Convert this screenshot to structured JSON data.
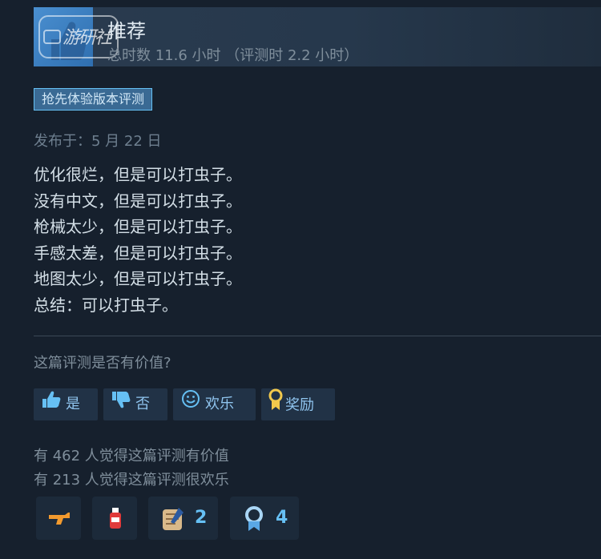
{
  "header": {
    "title": "推荐",
    "hours": "总时数 11.6 小时 （评测时 2.2 小时）",
    "watermark": "游研社"
  },
  "review": {
    "tag": "抢先体验版本评测",
    "posted": "发布于：5 月 22 日",
    "lines": [
      "优化很烂，但是可以打虫子。",
      "没有中文，但是可以打虫子。",
      "枪械太少，但是可以打虫子。",
      "手感太差，但是可以打虫子。",
      "地图太少，但是可以打虫子。",
      "总结：可以打虫子。"
    ]
  },
  "feedback": {
    "question": "这篇评测是否有价值?",
    "yes": "是",
    "no": "否",
    "funny": "欢乐",
    "award": "奖励",
    "helpful_count": "有 462 人觉得这篇评测有价值",
    "funny_count": "有 213 人觉得这篇评测很欢乐"
  },
  "awards": [
    {
      "icon": "gun-award-icon",
      "count": ""
    },
    {
      "icon": "bottle-award-icon",
      "count": ""
    },
    {
      "icon": "scroll-award-icon",
      "count": "2"
    },
    {
      "icon": "ribbon-award-icon",
      "count": "4"
    }
  ],
  "colors": {
    "background": "#16202d",
    "accent": "#66c0f4",
    "header_bg": "#2a3b4f"
  }
}
